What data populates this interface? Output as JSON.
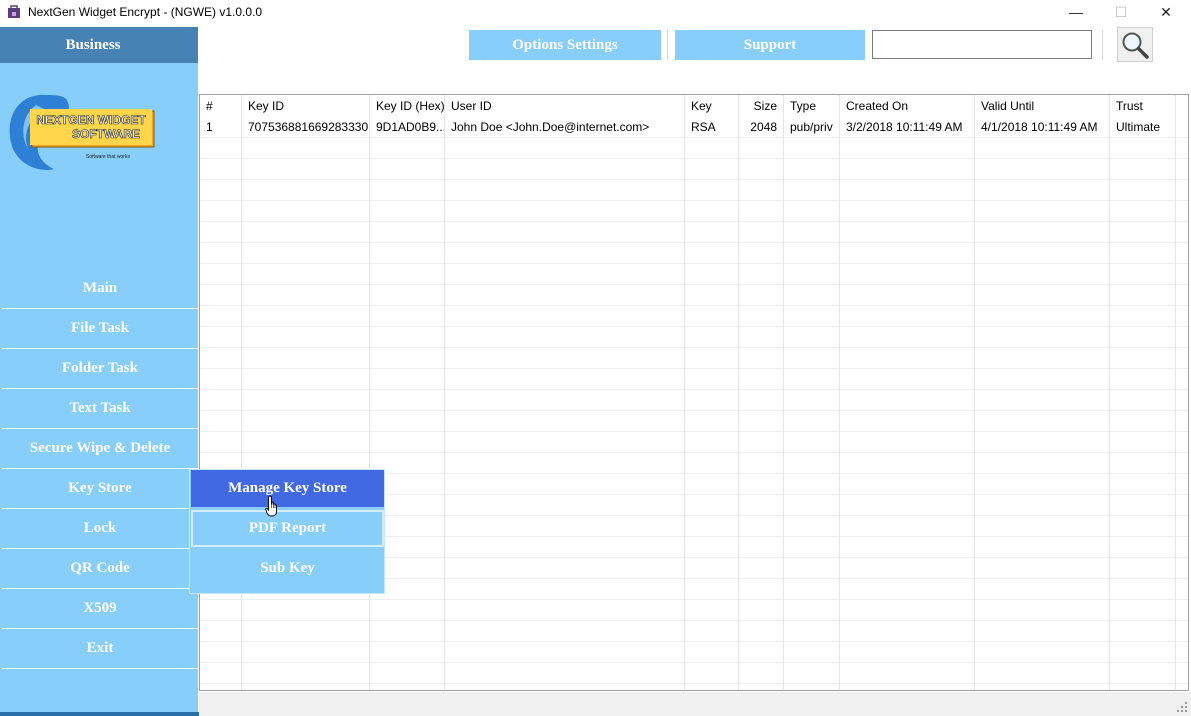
{
  "window": {
    "title": "NextGen Widget Encrypt - (NGWE) v1.0.0.0",
    "minimize_glyph": "—",
    "maximize_glyph": "☐",
    "close_glyph": "✕"
  },
  "sidebar": {
    "header": "Business",
    "logo_text": "NEXTGEN WIDGET SOFTWARE",
    "logo_tagline": "Software that works",
    "items": [
      {
        "label": "Main"
      },
      {
        "label": "File Task"
      },
      {
        "label": "Folder Task"
      },
      {
        "label": "Text Task"
      },
      {
        "label": "Secure Wipe & Delete"
      },
      {
        "label": "Key Store"
      },
      {
        "label": "Lock"
      },
      {
        "label": "QR Code"
      },
      {
        "label": "X509"
      },
      {
        "label": "Exit"
      }
    ]
  },
  "toolbar": {
    "options_label": "Options Settings",
    "support_label": "Support",
    "search_value": "",
    "search_placeholder": "",
    "search_icon": "magnifier-icon"
  },
  "grid": {
    "columns": [
      "#",
      "Key ID",
      "Key ID (Hex)",
      "User ID",
      "Key",
      "Size",
      "Type",
      "Created On",
      "Valid Until",
      "Trust"
    ],
    "rows": [
      [
        "1",
        "707536881669283330",
        "9D1AD0B9...",
        "John Doe <John.Doe@internet.com>",
        "RSA",
        "2048",
        "pub/priv",
        "3/2/2018 10:11:49 AM",
        "4/1/2018 10:11:49 AM",
        "Ultimate"
      ]
    ]
  },
  "popup_menu": {
    "items": [
      {
        "label": "Manage Key Store"
      },
      {
        "label": "PDF Report"
      },
      {
        "label": "Sub Key"
      }
    ]
  },
  "colors": {
    "sidebar_bg": "#87cefa",
    "sidebar_header_bg": "#4682b4",
    "popup_active_bg": "#4169e1"
  }
}
